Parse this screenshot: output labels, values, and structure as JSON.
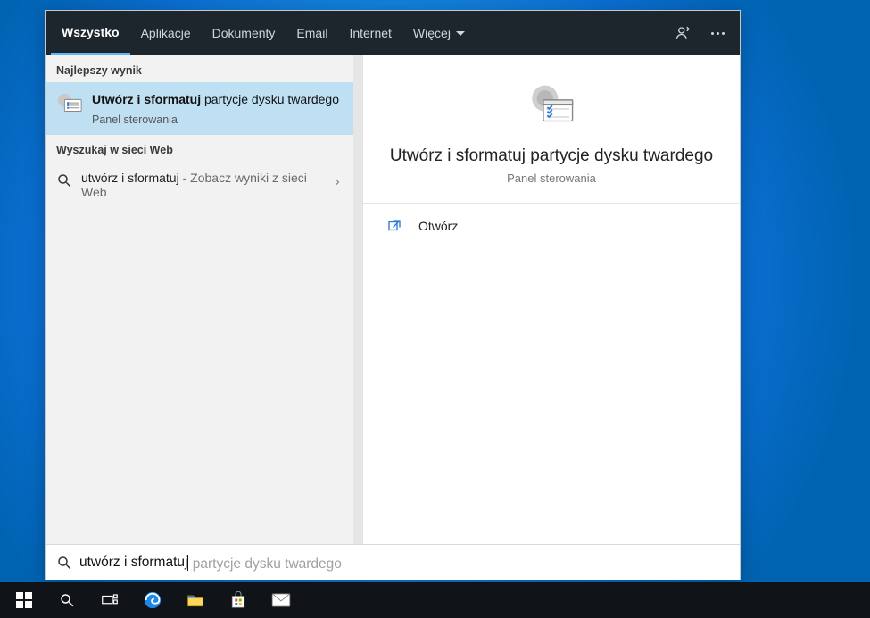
{
  "tabs": {
    "all": "Wszystko",
    "apps": "Aplikacje",
    "documents": "Dokumenty",
    "email": "Email",
    "internet": "Internet",
    "more": "Więcej"
  },
  "sections": {
    "best": "Najlepszy wynik",
    "web": "Wyszukaj w sieci Web"
  },
  "bestResult": {
    "titleBold": "Utwórz i sformatuj",
    "titleRest": " partycje dysku twardego",
    "category": "Panel sterowania"
  },
  "webResult": {
    "queryBold": "utwórz i sformatuj",
    "dash": " - ",
    "suffix": "Zobacz wyniki z sieci Web"
  },
  "preview": {
    "title": "Utwórz i sformatuj partycje dysku twardego",
    "category": "Panel sterowania",
    "openLabel": "Otwórz"
  },
  "search": {
    "typed": "utwórz i sformatuj",
    "suggestion": " partycje dysku twardego"
  }
}
